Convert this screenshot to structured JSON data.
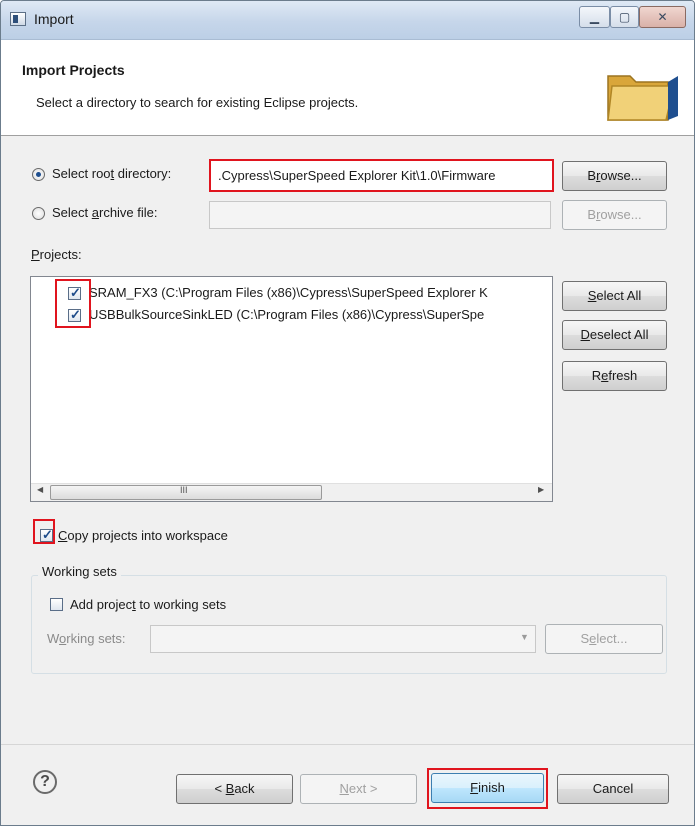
{
  "window": {
    "title": "Import"
  },
  "header": {
    "title": "Import Projects",
    "description": "Select a directory to search for existing Eclipse projects."
  },
  "source": {
    "root_label_pre": "Select roo",
    "root_label_u": "t",
    "root_label_post": " directory:",
    "root_value": ".Cypress\\SuperSpeed Explorer Kit\\1.0\\Firmware",
    "root_selected": true,
    "archive_label_pre": "Select ",
    "archive_label_u": "a",
    "archive_label_post": "rchive file:",
    "archive_value": "",
    "browse_pre": "B",
    "browse_u": "r",
    "browse_post": "owse..."
  },
  "projects": {
    "label_u": "P",
    "label_post": "rojects:",
    "items": [
      {
        "label": "SRAM_FX3 (C:\\Program Files (x86)\\Cypress\\SuperSpeed Explorer K",
        "checked": true
      },
      {
        "label": "USBBulkSourceSinkLED (C:\\Program Files (x86)\\Cypress\\SuperSpe",
        "checked": true
      }
    ],
    "scroll_left": "◀",
    "scroll_right": "▶",
    "scroll_grip": "III"
  },
  "list_buttons": {
    "select_all_u": "S",
    "select_all_post": "elect All",
    "deselect_all_u": "D",
    "deselect_all_post": "eselect All",
    "refresh_pre": "R",
    "refresh_u": "e",
    "refresh_post": "fresh"
  },
  "options": {
    "copy_label_pre": "",
    "copy_label_u": "C",
    "copy_label_post": "opy projects into workspace",
    "copy_checked": true
  },
  "working_sets": {
    "legend": "Working sets",
    "add_label_pre": "Add projec",
    "add_label_u": "t",
    "add_label_post": " to working sets",
    "add_checked": false,
    "combo_label_pre": "W",
    "combo_label_u": "o",
    "combo_label_post": "rking sets:",
    "combo_value": "",
    "select_pre": "S",
    "select_u": "e",
    "select_post": "lect..."
  },
  "footer": {
    "help": "?",
    "back_pre": "< ",
    "back_u": "B",
    "back_post": "ack",
    "next_u": "N",
    "next_post": "ext >",
    "finish_u": "F",
    "finish_post": "inish",
    "cancel": "Cancel"
  },
  "colors": {
    "highlight": "#e0141e",
    "accent": "#1f4f8f"
  }
}
